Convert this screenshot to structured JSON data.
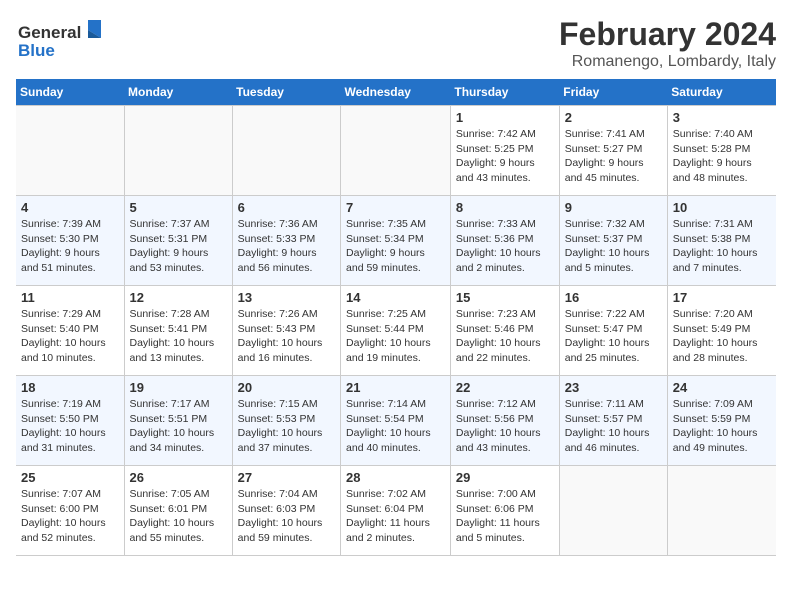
{
  "header": {
    "logo_line1": "General",
    "logo_line2": "Blue",
    "main_title": "February 2024",
    "subtitle": "Romanengo, Lombardy, Italy"
  },
  "days_of_week": [
    "Sunday",
    "Monday",
    "Tuesday",
    "Wednesday",
    "Thursday",
    "Friday",
    "Saturday"
  ],
  "weeks": [
    [
      {
        "day": "",
        "info": ""
      },
      {
        "day": "",
        "info": ""
      },
      {
        "day": "",
        "info": ""
      },
      {
        "day": "",
        "info": ""
      },
      {
        "day": "1",
        "info": "Sunrise: 7:42 AM\nSunset: 5:25 PM\nDaylight: 9 hours\nand 43 minutes."
      },
      {
        "day": "2",
        "info": "Sunrise: 7:41 AM\nSunset: 5:27 PM\nDaylight: 9 hours\nand 45 minutes."
      },
      {
        "day": "3",
        "info": "Sunrise: 7:40 AM\nSunset: 5:28 PM\nDaylight: 9 hours\nand 48 minutes."
      }
    ],
    [
      {
        "day": "4",
        "info": "Sunrise: 7:39 AM\nSunset: 5:30 PM\nDaylight: 9 hours\nand 51 minutes."
      },
      {
        "day": "5",
        "info": "Sunrise: 7:37 AM\nSunset: 5:31 PM\nDaylight: 9 hours\nand 53 minutes."
      },
      {
        "day": "6",
        "info": "Sunrise: 7:36 AM\nSunset: 5:33 PM\nDaylight: 9 hours\nand 56 minutes."
      },
      {
        "day": "7",
        "info": "Sunrise: 7:35 AM\nSunset: 5:34 PM\nDaylight: 9 hours\nand 59 minutes."
      },
      {
        "day": "8",
        "info": "Sunrise: 7:33 AM\nSunset: 5:36 PM\nDaylight: 10 hours\nand 2 minutes."
      },
      {
        "day": "9",
        "info": "Sunrise: 7:32 AM\nSunset: 5:37 PM\nDaylight: 10 hours\nand 5 minutes."
      },
      {
        "day": "10",
        "info": "Sunrise: 7:31 AM\nSunset: 5:38 PM\nDaylight: 10 hours\nand 7 minutes."
      }
    ],
    [
      {
        "day": "11",
        "info": "Sunrise: 7:29 AM\nSunset: 5:40 PM\nDaylight: 10 hours\nand 10 minutes."
      },
      {
        "day": "12",
        "info": "Sunrise: 7:28 AM\nSunset: 5:41 PM\nDaylight: 10 hours\nand 13 minutes."
      },
      {
        "day": "13",
        "info": "Sunrise: 7:26 AM\nSunset: 5:43 PM\nDaylight: 10 hours\nand 16 minutes."
      },
      {
        "day": "14",
        "info": "Sunrise: 7:25 AM\nSunset: 5:44 PM\nDaylight: 10 hours\nand 19 minutes."
      },
      {
        "day": "15",
        "info": "Sunrise: 7:23 AM\nSunset: 5:46 PM\nDaylight: 10 hours\nand 22 minutes."
      },
      {
        "day": "16",
        "info": "Sunrise: 7:22 AM\nSunset: 5:47 PM\nDaylight: 10 hours\nand 25 minutes."
      },
      {
        "day": "17",
        "info": "Sunrise: 7:20 AM\nSunset: 5:49 PM\nDaylight: 10 hours\nand 28 minutes."
      }
    ],
    [
      {
        "day": "18",
        "info": "Sunrise: 7:19 AM\nSunset: 5:50 PM\nDaylight: 10 hours\nand 31 minutes."
      },
      {
        "day": "19",
        "info": "Sunrise: 7:17 AM\nSunset: 5:51 PM\nDaylight: 10 hours\nand 34 minutes."
      },
      {
        "day": "20",
        "info": "Sunrise: 7:15 AM\nSunset: 5:53 PM\nDaylight: 10 hours\nand 37 minutes."
      },
      {
        "day": "21",
        "info": "Sunrise: 7:14 AM\nSunset: 5:54 PM\nDaylight: 10 hours\nand 40 minutes."
      },
      {
        "day": "22",
        "info": "Sunrise: 7:12 AM\nSunset: 5:56 PM\nDaylight: 10 hours\nand 43 minutes."
      },
      {
        "day": "23",
        "info": "Sunrise: 7:11 AM\nSunset: 5:57 PM\nDaylight: 10 hours\nand 46 minutes."
      },
      {
        "day": "24",
        "info": "Sunrise: 7:09 AM\nSunset: 5:59 PM\nDaylight: 10 hours\nand 49 minutes."
      }
    ],
    [
      {
        "day": "25",
        "info": "Sunrise: 7:07 AM\nSunset: 6:00 PM\nDaylight: 10 hours\nand 52 minutes."
      },
      {
        "day": "26",
        "info": "Sunrise: 7:05 AM\nSunset: 6:01 PM\nDaylight: 10 hours\nand 55 minutes."
      },
      {
        "day": "27",
        "info": "Sunrise: 7:04 AM\nSunset: 6:03 PM\nDaylight: 10 hours\nand 59 minutes."
      },
      {
        "day": "28",
        "info": "Sunrise: 7:02 AM\nSunset: 6:04 PM\nDaylight: 11 hours\nand 2 minutes."
      },
      {
        "day": "29",
        "info": "Sunrise: 7:00 AM\nSunset: 6:06 PM\nDaylight: 11 hours\nand 5 minutes."
      },
      {
        "day": "",
        "info": ""
      },
      {
        "day": "",
        "info": ""
      }
    ]
  ]
}
